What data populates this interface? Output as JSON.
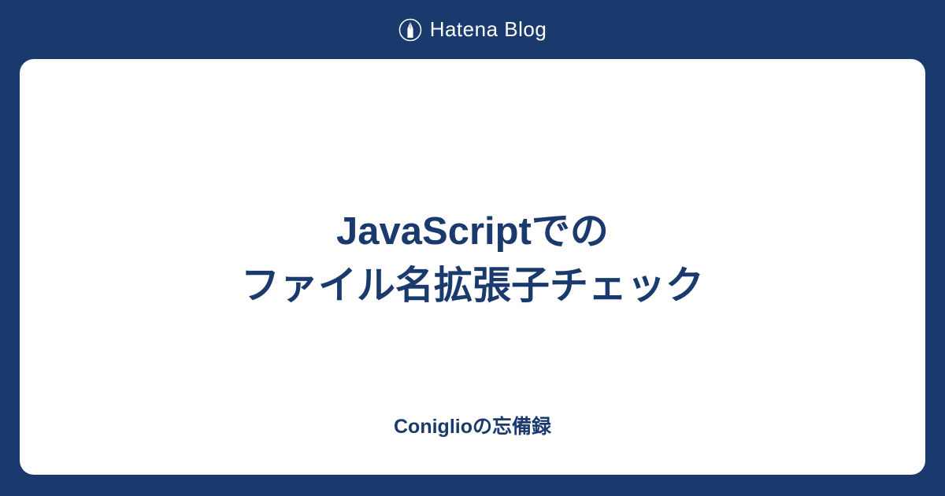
{
  "header": {
    "logo_text": "Hatena Blog"
  },
  "card": {
    "title_line1": "JavaScriptでの",
    "title_line2": "ファイル名拡張子チェック",
    "blog_name": "Coniglioの忘備録"
  }
}
